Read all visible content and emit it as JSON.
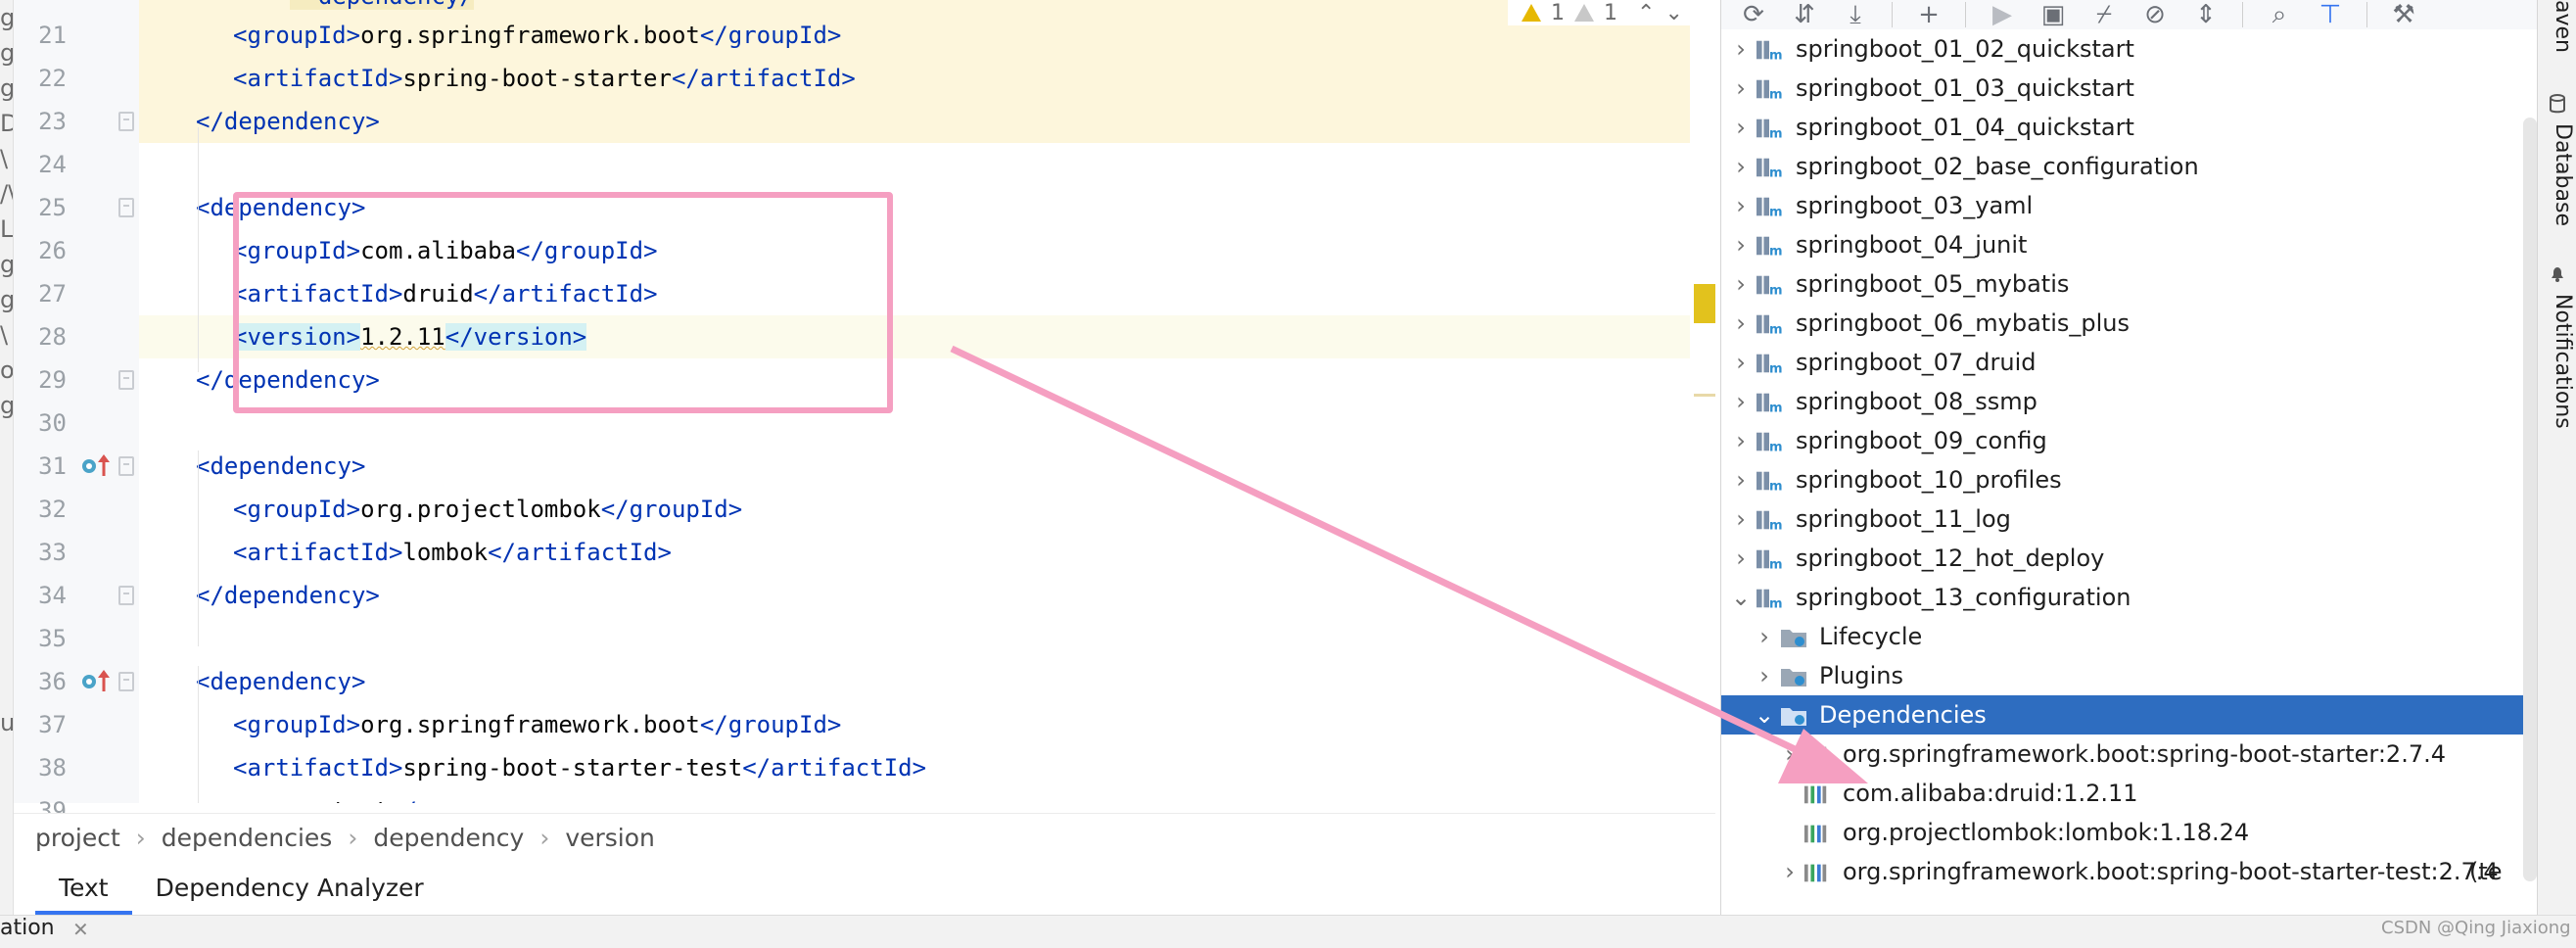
{
  "left_strip_chars": [
    "g.",
    "g.",
    "g.",
    "D",
    "\\",
    "/\\",
    "L",
    "g.",
    "g.",
    "\\",
    "or",
    "g.",
    "",
    "",
    "",
    "",
    "",
    "",
    "",
    "",
    "u"
  ],
  "editor": {
    "lines": [
      {
        "num": "21",
        "indent": 2,
        "parts": [
          {
            "t": "<",
            "c": "tag"
          },
          {
            "t": "groupId",
            "c": "tag"
          },
          {
            "t": ">",
            "c": "tag"
          },
          {
            "t": "org.springframework.boot",
            "c": "t-plain"
          },
          {
            "t": "</",
            "c": "tag"
          },
          {
            "t": "groupId",
            "c": "tag"
          },
          {
            "t": ">",
            "c": "tag"
          }
        ]
      },
      {
        "num": "22",
        "indent": 2,
        "parts": [
          {
            "t": "<",
            "c": "tag"
          },
          {
            "t": "artifactId",
            "c": "tag"
          },
          {
            "t": ">",
            "c": "tag"
          },
          {
            "t": "spring-boot-starter",
            "c": "t-plain"
          },
          {
            "t": "</",
            "c": "tag"
          },
          {
            "t": "artifactId",
            "c": "tag"
          },
          {
            "t": ">",
            "c": "tag"
          }
        ]
      },
      {
        "num": "23",
        "indent": 1,
        "parts": [
          {
            "t": "</",
            "c": "tag"
          },
          {
            "t": "dependency",
            "c": "tag"
          },
          {
            "t": ">",
            "c": "tag"
          }
        ]
      },
      {
        "num": "24",
        "indent": 0,
        "parts": []
      },
      {
        "num": "25",
        "indent": 1,
        "parts": [
          {
            "t": "<",
            "c": "tag"
          },
          {
            "t": "dependency",
            "c": "tag"
          },
          {
            "t": ">",
            "c": "tag"
          }
        ]
      },
      {
        "num": "26",
        "indent": 2,
        "parts": [
          {
            "t": "<",
            "c": "tag"
          },
          {
            "t": "groupId",
            "c": "tag"
          },
          {
            "t": ">",
            "c": "tag"
          },
          {
            "t": "com.alibaba",
            "c": "t-plain"
          },
          {
            "t": "</",
            "c": "tag"
          },
          {
            "t": "groupId",
            "c": "tag"
          },
          {
            "t": ">",
            "c": "tag"
          }
        ]
      },
      {
        "num": "27",
        "indent": 2,
        "parts": [
          {
            "t": "<",
            "c": "tag"
          },
          {
            "t": "artifactId",
            "c": "tag"
          },
          {
            "t": ">",
            "c": "tag"
          },
          {
            "t": "druid",
            "c": "t-plain"
          },
          {
            "t": "</",
            "c": "tag"
          },
          {
            "t": "artifactId",
            "c": "tag"
          },
          {
            "t": ">",
            "c": "tag"
          }
        ]
      },
      {
        "num": "28",
        "indent": 2,
        "parts": [
          {
            "t": "<version>",
            "c": "tag tag-hl"
          },
          {
            "t": "1.2.11",
            "c": "t-plain squiggle"
          },
          {
            "t": "</version>",
            "c": "tag tag-hl"
          }
        ]
      },
      {
        "num": "29",
        "indent": 1,
        "parts": [
          {
            "t": "</",
            "c": "tag"
          },
          {
            "t": "dependency",
            "c": "tag"
          },
          {
            "t": ">",
            "c": "tag"
          }
        ]
      },
      {
        "num": "30",
        "indent": 0,
        "parts": []
      },
      {
        "num": "31",
        "indent": 1,
        "parts": [
          {
            "t": "<",
            "c": "tag"
          },
          {
            "t": "dependency",
            "c": "tag"
          },
          {
            "t": ">",
            "c": "tag"
          }
        ]
      },
      {
        "num": "32",
        "indent": 2,
        "parts": [
          {
            "t": "<",
            "c": "tag"
          },
          {
            "t": "groupId",
            "c": "tag"
          },
          {
            "t": ">",
            "c": "tag"
          },
          {
            "t": "org.projectlombok",
            "c": "t-plain"
          },
          {
            "t": "</",
            "c": "tag"
          },
          {
            "t": "groupId",
            "c": "tag"
          },
          {
            "t": ">",
            "c": "tag"
          }
        ]
      },
      {
        "num": "33",
        "indent": 2,
        "parts": [
          {
            "t": "<",
            "c": "tag"
          },
          {
            "t": "artifactId",
            "c": "tag"
          },
          {
            "t": ">",
            "c": "tag"
          },
          {
            "t": "lombok",
            "c": "t-plain"
          },
          {
            "t": "</",
            "c": "tag"
          },
          {
            "t": "artifactId",
            "c": "tag"
          },
          {
            "t": ">",
            "c": "tag"
          }
        ]
      },
      {
        "num": "34",
        "indent": 1,
        "parts": [
          {
            "t": "</",
            "c": "tag"
          },
          {
            "t": "dependency",
            "c": "tag"
          },
          {
            "t": ">",
            "c": "tag"
          }
        ]
      },
      {
        "num": "35",
        "indent": 0,
        "parts": []
      },
      {
        "num": "36",
        "indent": 1,
        "parts": [
          {
            "t": "<",
            "c": "tag"
          },
          {
            "t": "dependency",
            "c": "tag"
          },
          {
            "t": ">",
            "c": "tag"
          }
        ]
      },
      {
        "num": "37",
        "indent": 2,
        "parts": [
          {
            "t": "<",
            "c": "tag"
          },
          {
            "t": "groupId",
            "c": "tag"
          },
          {
            "t": ">",
            "c": "tag"
          },
          {
            "t": "org.springframework.boot",
            "c": "t-plain"
          },
          {
            "t": "</",
            "c": "tag"
          },
          {
            "t": "groupId",
            "c": "tag"
          },
          {
            "t": ">",
            "c": "tag"
          }
        ]
      },
      {
        "num": "38",
        "indent": 2,
        "parts": [
          {
            "t": "<",
            "c": "tag"
          },
          {
            "t": "artifactId",
            "c": "tag"
          },
          {
            "t": ">",
            "c": "tag"
          },
          {
            "t": "spring-boot-starter-test",
            "c": "t-plain"
          },
          {
            "t": "</",
            "c": "tag"
          },
          {
            "t": "artifactId",
            "c": "tag"
          },
          {
            "t": ">",
            "c": "tag"
          }
        ]
      },
      {
        "num": "39",
        "indent": 2,
        "parts": [
          {
            "t": "<",
            "c": "tag"
          },
          {
            "t": "scope",
            "c": "tag"
          },
          {
            "t": ">",
            "c": "tag"
          },
          {
            "t": "test",
            "c": "t-plain"
          },
          {
            "t": "</",
            "c": "tag"
          },
          {
            "t": "scope",
            "c": "tag"
          },
          {
            "t": ">",
            "c": "tag"
          }
        ]
      }
    ],
    "top_partial_tag": "dependency",
    "yellow_lines": [
      "21",
      "22",
      "23"
    ],
    "caret_line": "28",
    "override_lines": [
      "31",
      "36"
    ],
    "fold_open_lines": [
      "25",
      "31",
      "36"
    ],
    "fold_close_lines": [
      "23",
      "29",
      "34"
    ]
  },
  "inspection": {
    "warnings": "1",
    "weak_warnings": "1",
    "up": "⌃",
    "down": "⌄"
  },
  "breadcrumb": [
    "project",
    "dependencies",
    "dependency",
    "version"
  ],
  "bottom_tabs": [
    {
      "label": "Text",
      "active": true
    },
    {
      "label": "Dependency Analyzer",
      "active": false
    }
  ],
  "status": {
    "label": "ation",
    "close": "✕"
  },
  "maven": {
    "toolbar_icons": [
      "reload-icon",
      "reimport-icon",
      "download-icon",
      "add-icon",
      "run-icon",
      "execute-goal-icon",
      "toggle-icon",
      "skip-tests-icon",
      "collapse-icon",
      "analyze-icon",
      "show-deps-icon",
      "settings-icon"
    ],
    "modules": [
      "springboot_01_02_quickstart",
      "springboot_01_03_quickstart",
      "springboot_01_04_quickstart",
      "springboot_02_base_configuration",
      "springboot_03_yaml",
      "springboot_04_junit",
      "springboot_05_mybatis",
      "springboot_06_mybatis_plus",
      "springboot_07_druid",
      "springboot_08_ssmp",
      "springboot_09_config",
      "springboot_10_profiles",
      "springboot_11_log",
      "springboot_12_hot_deploy",
      "springboot_13_configuration"
    ],
    "expanded_module": "springboot_13_configuration",
    "children": [
      {
        "label": "Lifecycle",
        "expanded": false
      },
      {
        "label": "Plugins",
        "expanded": false
      },
      {
        "label": "Dependencies",
        "expanded": true,
        "selected": true
      }
    ],
    "dependencies": [
      {
        "label": "org.springframework.boot:spring-boot-starter:2.7.4",
        "expandable": true,
        "suffix": ""
      },
      {
        "label": "com.alibaba:druid:1.2.11",
        "expandable": false,
        "suffix": ""
      },
      {
        "label": "org.projectlombok:lombok:1.18.24",
        "expandable": false,
        "suffix": ""
      },
      {
        "label": "org.springframework.boot:spring-boot-starter-test:2.7.4",
        "expandable": true,
        "suffix": " (te"
      }
    ]
  },
  "side_strip": {
    "top_label": "aven",
    "database": "Database",
    "notifications": "Notifications"
  },
  "watermark": "CSDN @Qing Jiaxiong",
  "colors": {
    "tag": "#0033b3",
    "selection": "#2e6dc0",
    "annotation": "#f59fc1",
    "warning": "#e6b800"
  }
}
